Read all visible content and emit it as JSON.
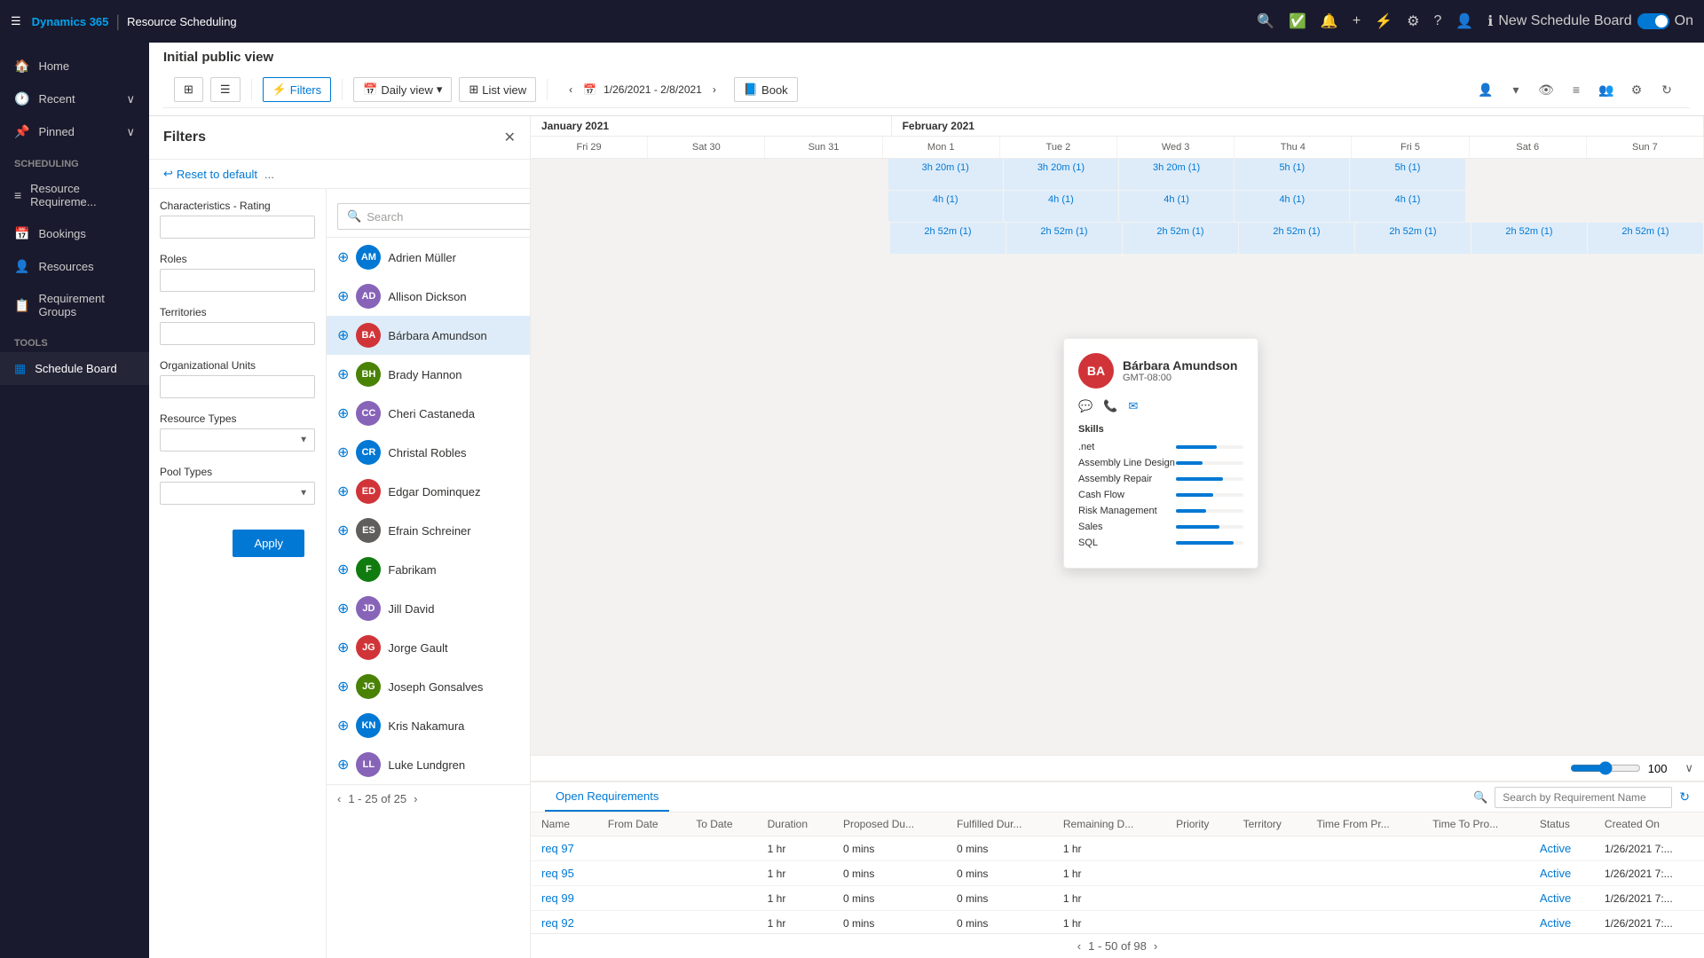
{
  "app": {
    "brand": "Dynamics 365",
    "separator": "|",
    "app_name": "Resource Scheduling"
  },
  "topnav": {
    "new_schedule_board": "New Schedule Board",
    "toggle_label": "On"
  },
  "sidebar": {
    "hamburger": "☰",
    "items": [
      {
        "id": "home",
        "label": "Home",
        "icon": "🏠"
      },
      {
        "id": "recent",
        "label": "Recent",
        "icon": "🕐",
        "has_arrow": true
      },
      {
        "id": "pinned",
        "label": "Pinned",
        "icon": "📌",
        "has_arrow": true
      },
      {
        "id": "scheduling",
        "label": "Scheduling",
        "section": true
      },
      {
        "id": "resource-req",
        "label": "Resource Requireme...",
        "icon": "👥"
      },
      {
        "id": "bookings",
        "label": "Bookings",
        "icon": "📅"
      },
      {
        "id": "resources",
        "label": "Resources",
        "icon": "👤"
      },
      {
        "id": "req-groups",
        "label": "Requirement Groups",
        "icon": "📋"
      },
      {
        "id": "tools",
        "label": "Tools",
        "section": true
      },
      {
        "id": "schedule-board",
        "label": "Schedule Board",
        "icon": "📊",
        "active": true
      }
    ]
  },
  "page": {
    "title": "Initial public view"
  },
  "toolbar": {
    "grid_icon": "⊞",
    "gantt_icon": "☰",
    "filters_label": "Filters",
    "daily_view_label": "Daily view",
    "list_view_label": "List view",
    "date_range": "1/26/2021 - 2/8/2021",
    "book_label": "Book"
  },
  "filters_panel": {
    "title": "Filters",
    "reset_label": "Reset to default",
    "more_icon": "...",
    "search_placeholder": "Search",
    "characteristics_label": "Characteristics - Rating",
    "roles_label": "Roles",
    "territories_label": "Territories",
    "org_units_label": "Organizational Units",
    "resource_types_label": "Resource Types",
    "pool_types_label": "Pool Types",
    "apply_label": "Apply"
  },
  "resources": {
    "list": [
      {
        "id": 1,
        "name": "Adrien Müller",
        "initials": "AM",
        "color": "#0078d4"
      },
      {
        "id": 2,
        "name": "Allison Dickson",
        "initials": "AD",
        "color": "#8764b8"
      },
      {
        "id": 3,
        "name": "Bárbara Amundson",
        "initials": "BA",
        "color": "#d13438",
        "selected": true
      },
      {
        "id": 4,
        "name": "Brady Hannon",
        "initials": "BH",
        "color": "#498205"
      },
      {
        "id": 5,
        "name": "Cheri Castaneda",
        "initials": "CC",
        "color": "#8764b8"
      },
      {
        "id": 6,
        "name": "Christal Robles",
        "initials": "CR",
        "color": "#0078d4"
      },
      {
        "id": 7,
        "name": "Edgar Dominquez",
        "initials": "ED",
        "color": "#d13438"
      },
      {
        "id": 8,
        "name": "Efrain Schreiner",
        "initials": "ES",
        "color": "#605e5c"
      },
      {
        "id": 9,
        "name": "Fabrikam",
        "initials": "F",
        "color": "#107c10"
      },
      {
        "id": 10,
        "name": "Jill David",
        "initials": "JD",
        "color": "#8764b8"
      },
      {
        "id": 11,
        "name": "Jorge Gault",
        "initials": "JG",
        "color": "#d13438"
      },
      {
        "id": 12,
        "name": "Joseph Gonsalves",
        "initials": "JG",
        "color": "#498205"
      },
      {
        "id": 13,
        "name": "Kris Nakamura",
        "initials": "KN",
        "color": "#0078d4"
      },
      {
        "id": 14,
        "name": "Luke Lundgren",
        "initials": "LL",
        "color": "#8764b8"
      }
    ],
    "pagination": "1 - 25 of 25"
  },
  "popup": {
    "name": "Bárbara Amundson",
    "initials": "BA",
    "timezone": "GMT-08:00",
    "skills_title": "Skills",
    "skills": [
      {
        "name": ".net",
        "pct": 60
      },
      {
        "name": "Assembly Line Design",
        "pct": 40
      },
      {
        "name": "Assembly Repair",
        "pct": 70
      },
      {
        "name": "Cash Flow",
        "pct": 55
      },
      {
        "name": "Risk Management",
        "pct": 45
      },
      {
        "name": "Sales",
        "pct": 65
      },
      {
        "name": "SQL",
        "pct": 85
      }
    ]
  },
  "calendar": {
    "months": [
      {
        "label": "January 2021",
        "span": 3
      },
      {
        "label": "February 2021",
        "span": 7
      }
    ],
    "days": [
      {
        "label": "Fri 29"
      },
      {
        "label": "Sat 30"
      },
      {
        "label": "Sun 31"
      },
      {
        "label": "Mon 1"
      },
      {
        "label": "Tue 2"
      },
      {
        "label": "Wed 3"
      },
      {
        "label": "Thu 4"
      },
      {
        "label": "Fri 5"
      },
      {
        "label": "Sat 6"
      },
      {
        "label": "Sun 7"
      }
    ],
    "rows": [
      [
        "",
        "",
        "",
        "3h 20m (1)",
        "3h 20m (1)",
        "3h 20m (1)",
        "5h (1)",
        "5h (1)",
        "",
        ""
      ],
      [
        "",
        "",
        "",
        "4h (1)",
        "4h (1)",
        "4h (1)",
        "4h (1)",
        "4h (1)",
        "",
        ""
      ],
      [
        "",
        "",
        "",
        "2h 52m (1)",
        "2h 52m (1)",
        "2h 52m (1)",
        "2h 52m (1)",
        "2h 52m (1)",
        "2h 52m (1)",
        "2h 52m (1)"
      ]
    ],
    "zoom_value": "100"
  },
  "bottom": {
    "tab_label": "Open Requirements",
    "search_placeholder": "Search by Requirement Name",
    "columns": [
      "Name",
      "From Date",
      "To Date",
      "Duration",
      "Proposed Du...",
      "Fulfilled Dur...",
      "Remaining D...",
      "Priority",
      "Territory",
      "Time From Pr...",
      "Time To Pro...",
      "Status",
      "Created On"
    ],
    "rows": [
      {
        "name": "req 97",
        "from_date": "",
        "to_date": "",
        "duration": "1 hr",
        "proposed": "0 mins",
        "fulfilled": "0 mins",
        "remaining": "1 hr",
        "priority": "",
        "territory": "",
        "time_from": "",
        "time_to": "",
        "status": "Active",
        "created": "1/26/2021 7:..."
      },
      {
        "name": "req 95",
        "from_date": "",
        "to_date": "",
        "duration": "1 hr",
        "proposed": "0 mins",
        "fulfilled": "0 mins",
        "remaining": "1 hr",
        "priority": "",
        "territory": "",
        "time_from": "",
        "time_to": "",
        "status": "Active",
        "created": "1/26/2021 7:..."
      },
      {
        "name": "req 99",
        "from_date": "",
        "to_date": "",
        "duration": "1 hr",
        "proposed": "0 mins",
        "fulfilled": "0 mins",
        "remaining": "1 hr",
        "priority": "",
        "territory": "",
        "time_from": "",
        "time_to": "",
        "status": "Active",
        "created": "1/26/2021 7:..."
      },
      {
        "name": "req 92",
        "from_date": "",
        "to_date": "",
        "duration": "1 hr",
        "proposed": "0 mins",
        "fulfilled": "0 mins",
        "remaining": "1 hr",
        "priority": "",
        "territory": "",
        "time_from": "",
        "time_to": "",
        "status": "Active",
        "created": "1/26/2021 7:..."
      }
    ],
    "pagination": "1 - 50 of 98"
  }
}
